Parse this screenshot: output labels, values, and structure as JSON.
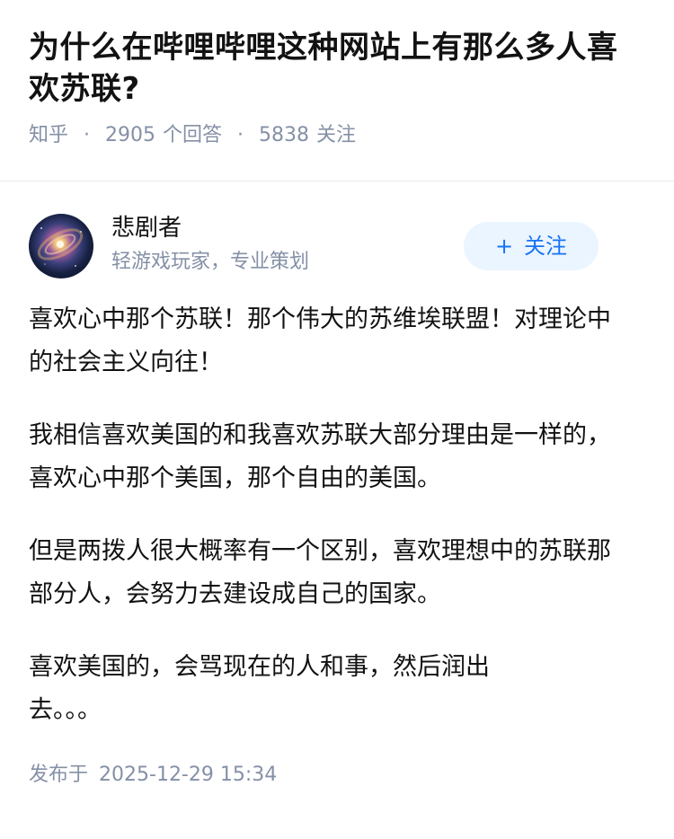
{
  "question": {
    "title": "为什么在哔哩哔哩这种网站上有那么多人喜欢苏联?",
    "source": "知乎",
    "separator": "·",
    "answer_count": "2905",
    "answer_label": "个回答",
    "follow_count": "5838",
    "follow_label": "关注"
  },
  "author": {
    "name": "悲剧者",
    "bio": "轻游戏玩家，专业策划",
    "avatar_icon": "galaxy-avatar",
    "follow_button": {
      "icon": "plus-icon",
      "icon_glyph": "+",
      "label": "关注"
    }
  },
  "answer": {
    "paragraphs": [
      "喜欢心中那个苏联！那个伟大的苏维埃联盟！对理论中的社会主义向往！",
      "我相信喜欢美国的和我喜欢苏联大部分理由是一样的，喜欢心中那个美国，那个自由的美国。",
      "但是两拨人很大概率有一个区别，喜欢理想中的苏联那部分人，会努力去建设成自己的国家。",
      "喜欢美国的，会骂现在的人和事，然后润出去。。。"
    ],
    "publish_label": "发布于",
    "publish_time": "2025-12-29 15:34"
  },
  "colors": {
    "text_primary": "#121212",
    "text_secondary": "#8590a6",
    "accent": "#1772f6",
    "follow_bg": "#ebf5ff",
    "divider": "#ebebeb"
  }
}
